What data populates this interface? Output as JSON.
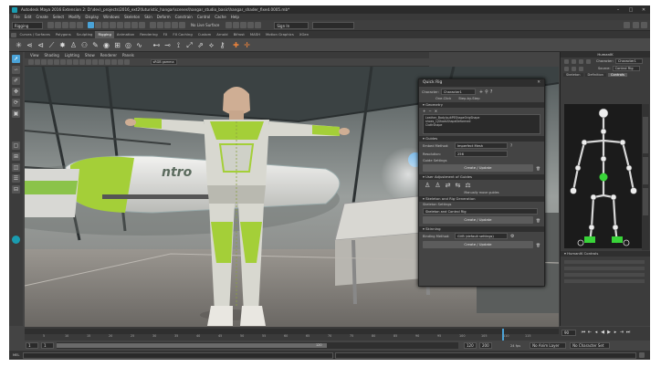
{
  "window": {
    "title": "Autodesk Maya 2016 Extension 2: D:\\dev\\_projects\\2016_ext2\\futuristic_hangar\\scenes\\hangar_studio_basic\\hangar_shader_fixed.0005.mb*",
    "controls": [
      "–",
      "□",
      "✕"
    ]
  },
  "menubar": {
    "items": [
      "File",
      "Edit",
      "Create",
      "Select",
      "Modify",
      "Display",
      "Windows",
      "Skeleton",
      "Skin",
      "Deform",
      "Constrain",
      "Control",
      "Cache",
      "Help"
    ]
  },
  "statusline": {
    "mode": "Rigging",
    "no_live_surface": "No Live Surface",
    "sign_in": "Sign In"
  },
  "shelf": {
    "tabs": [
      "Curves / Surfaces",
      "Polygons",
      "Sculpting",
      "Rigging",
      "Animation",
      "Rendering",
      "FX",
      "FX Caching",
      "Custom",
      "Arnold",
      "Bifrost",
      "MASH",
      "Motion Graphics",
      "XGen"
    ],
    "active_tab": "Rigging"
  },
  "viewport": {
    "menu": [
      "View",
      "Shading",
      "Lighting",
      "Show",
      "Renderer",
      "Panels"
    ],
    "color_space": "sRGB gamma",
    "ship_text": "ntro"
  },
  "quick_rig": {
    "title": "Quick Rig",
    "character_label": "Character:",
    "character_value": "Character1",
    "mode_step_by_step": "Step-by-Step",
    "mode_one_click": "One-Click",
    "sections": {
      "geometry": "Geometry",
      "guides": "Guides",
      "user_adjustment": "User Adjustment of Guides",
      "skeleton": "Skeleton and Rig Generation",
      "skinning": "Skinning"
    },
    "geometry_list": [
      "Leather_Body|suitPEShapeOrigShape",
      "shoes_1|ShoesShapeDeformed",
      "ClothShape"
    ],
    "embed_method_label": "Embed Method:",
    "embed_method": "Imperfect Mesh",
    "resolution_label": "Resolution:",
    "resolution": "256",
    "guide_settings": "Guide Settings",
    "create_update": "Create / Update",
    "mirror_guides": "Manually move guides",
    "skeleton_settings": "Skeleton Settings",
    "skeleton_mode": "Skeleton and Control Rig",
    "binding_label": "Binding Method:",
    "binding_method": "GVB (default settings)"
  },
  "hik": {
    "title": "HumanIK",
    "character_label": "Character:",
    "character_value": "Character1",
    "source_label": "Source:",
    "source_value": "Control Rig",
    "tabs": [
      "Skeleton",
      "Definition",
      "Controls"
    ],
    "active_tab": "Controls",
    "controls_header": "HumanIK Controls",
    "side_tabs": [
      "Attribute Editor",
      "Modeling Toolkit",
      "Channel Box"
    ]
  },
  "timeline": {
    "ticks": [
      "5",
      "10",
      "15",
      "20",
      "25",
      "30",
      "35",
      "40",
      "45",
      "50",
      "55",
      "60",
      "65",
      "70",
      "75",
      "80",
      "85",
      "90",
      "95",
      "100",
      "105",
      "110",
      "115"
    ],
    "current_frame": "90",
    "range_start": "1",
    "range_inner_start": "1",
    "range_end_marker": "120",
    "range_inner_end": "120",
    "range_out": "200",
    "anim_layer": "No Anim Layer",
    "char_set": "No Character Set",
    "fps": "24 fps"
  },
  "cmdline": {
    "lang": "MEL"
  },
  "colors": {
    "accent": "#4aa3d8",
    "active_tab": "#5b5b5b",
    "hik_green": "#39d439",
    "suit_green": "#8bc34a"
  }
}
